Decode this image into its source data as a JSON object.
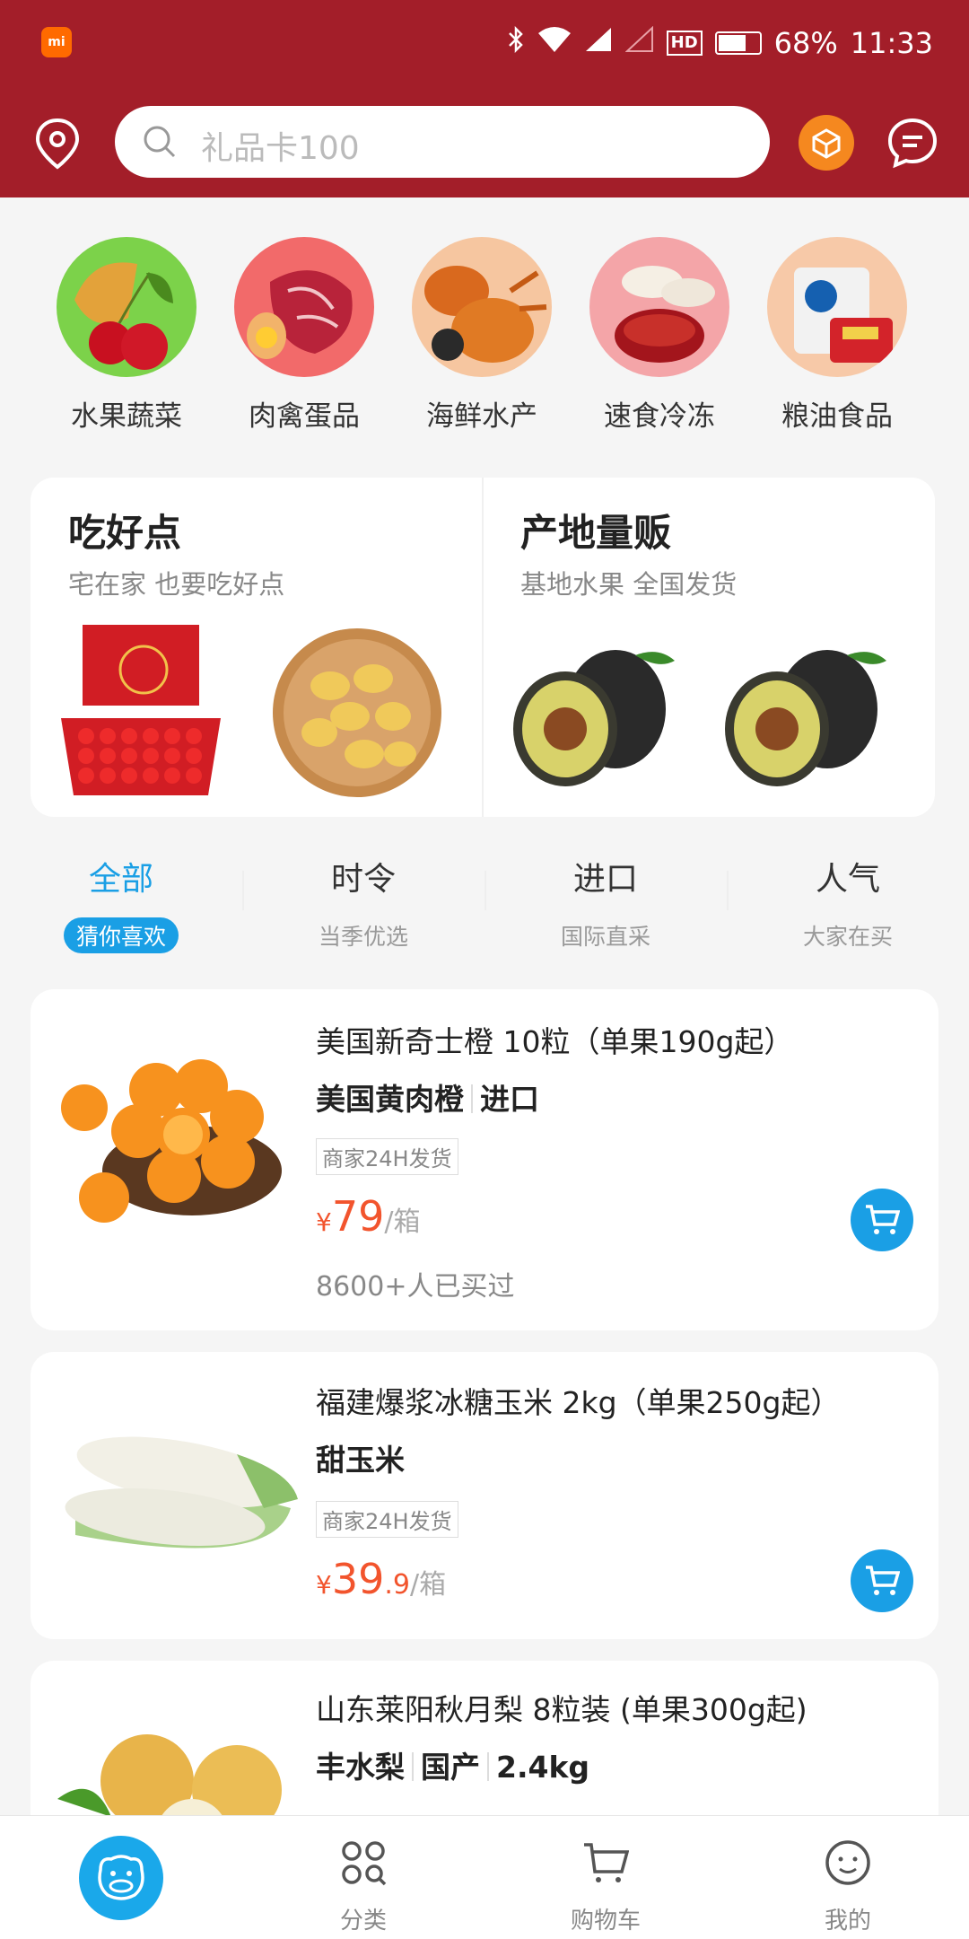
{
  "status_bar": {
    "battery": "68%",
    "time": "11:33",
    "network_badge": "HD"
  },
  "header": {
    "search_placeholder": "礼品卡100",
    "icons": [
      "location-pin-icon",
      "search-icon",
      "gift-box-icon",
      "message-icon"
    ],
    "bg_color": "#a31e29"
  },
  "categories": [
    {
      "label": "水果蔬菜"
    },
    {
      "label": "肉禽蛋品"
    },
    {
      "label": "海鲜水产"
    },
    {
      "label": "速食冷冻"
    },
    {
      "label": "粮油食品"
    }
  ],
  "promo": {
    "left": {
      "title": "吃好点",
      "subtitle": "宅在家 也要吃好点"
    },
    "right": {
      "title": "产地量贩",
      "subtitle": "基地水果 全国发货"
    }
  },
  "tabs": [
    {
      "title": "全部",
      "subtitle": "猜你喜欢",
      "active": true
    },
    {
      "title": "时令",
      "subtitle": "当季优选"
    },
    {
      "title": "进口",
      "subtitle": "国际直采"
    },
    {
      "title": "人气",
      "subtitle": "大家在买"
    }
  ],
  "products": [
    {
      "name": "美国新奇士橙 10粒（单果190g起）",
      "tags": [
        "美国黄肉橙",
        "进口"
      ],
      "shipping": "商家24H发货",
      "currency": "¥",
      "price_int": "79",
      "price_dec": "",
      "unit": "/箱",
      "sold": "8600+人已买过"
    },
    {
      "name": "福建爆浆冰糖玉米 2kg（单果250g起）",
      "tags": [
        "甜玉米"
      ],
      "shipping": "商家24H发货",
      "currency": "¥",
      "price_int": "39",
      "price_dec": ".9",
      "unit": "/箱"
    },
    {
      "name": "山东莱阳秋月梨 8粒装 (单果300g起)",
      "tags": [
        "丰水梨",
        "国产",
        "2.4kg"
      ]
    }
  ],
  "bottom_nav": [
    {
      "label": "",
      "icon": "hippo-home-icon",
      "active": true
    },
    {
      "label": "分类",
      "icon": "category-grid-icon"
    },
    {
      "label": "购物车",
      "icon": "cart-icon"
    },
    {
      "label": "我的",
      "icon": "smiley-profile-icon"
    }
  ],
  "accent_color": "#1a9fe5",
  "price_color": "#f2542d"
}
